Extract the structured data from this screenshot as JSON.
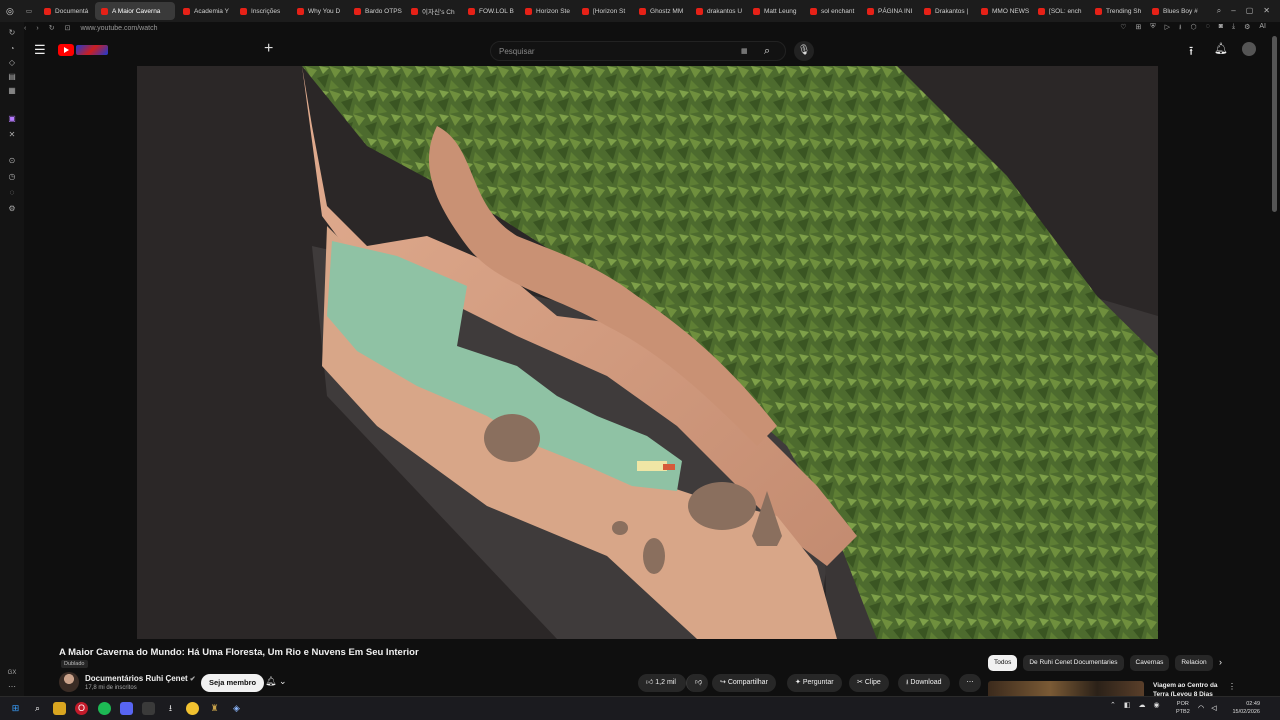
{
  "browser": {
    "tabs": [
      {
        "label": "Documentá",
        "active": false
      },
      {
        "label": "A Maior Caverna",
        "active": true
      },
      {
        "label": "Academia Y",
        "active": false
      },
      {
        "label": "Inscrições",
        "active": false
      },
      {
        "label": "Why You D",
        "active": false
      },
      {
        "label": "Bardo OTPS",
        "active": false
      },
      {
        "label": "이자신's Ch",
        "active": false
      },
      {
        "label": "FOW.LOL B",
        "active": false
      },
      {
        "label": "Horizon Ste",
        "active": false
      },
      {
        "label": "[Horizon St",
        "active": false
      },
      {
        "label": "Ghostz MM",
        "active": false
      },
      {
        "label": "drakantos U",
        "active": false
      },
      {
        "label": "Matt Leung",
        "active": false
      },
      {
        "label": "sol enchant",
        "active": false
      },
      {
        "label": "PÁGINA INI",
        "active": false
      },
      {
        "label": "Drakantos |",
        "active": false
      },
      {
        "label": "MMO NEWS",
        "active": false
      },
      {
        "label": "[SOL: ench",
        "active": false
      },
      {
        "label": "Trending Sh",
        "active": false
      },
      {
        "label": "Blues Boy #",
        "active": false
      }
    ],
    "url": "www.youtube.com/watch",
    "ai_label": "AI"
  },
  "sidebar_bottom_label": "GX",
  "youtube": {
    "search_placeholder": "Pesquisar",
    "video_title": "A Maior Caverna do Mundo: Há Uma Floresta, Um Rio e Nuvens Em Seu Interior",
    "dubbed_badge": "Dublado",
    "channel_name": "Documentários Ruhi Çenet",
    "subscribers": "17,8 mi de inscritos",
    "join_label": "Seja membro",
    "like_count": "1,2 mil",
    "share_label": "Compartilhar",
    "ask_label": "Perguntar",
    "clip_label": "Clipe",
    "download_label": "Download",
    "chips": [
      {
        "label": "Todos",
        "selected": true
      },
      {
        "label": "De Ruhi Cenet Documentaries",
        "selected": false
      },
      {
        "label": "Cavernas",
        "selected": false
      },
      {
        "label": "Relacion",
        "selected": false
      }
    ],
    "recommendation_title": "Viagem ao Centro da Terra (Levou 8 Dias"
  },
  "taskbar": {
    "lang_line1": "POR",
    "lang_line2": "PTB2",
    "time": "02:49",
    "date": "15/02/2026"
  },
  "colors": {
    "brand_red": "#ff0000",
    "background": "#0f0f0f",
    "foliage": "#4d6b2e",
    "rock": "#d9a386",
    "river": "#8fc2a4"
  }
}
